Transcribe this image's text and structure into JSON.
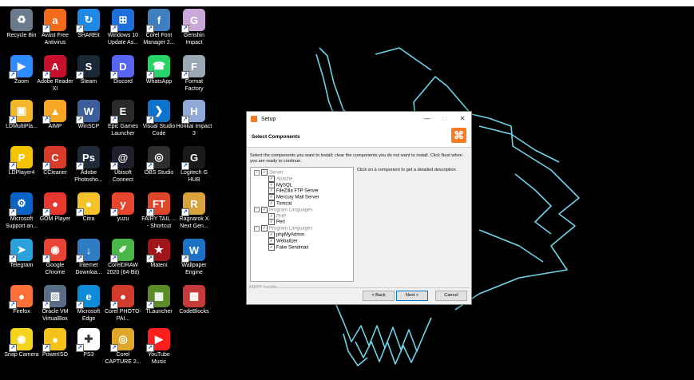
{
  "desktop": {
    "icons": [
      {
        "label": "Recycle Bin",
        "color": "#6b7b8c",
        "glyph": "♻",
        "shortcut": false
      },
      {
        "label": "Avast Free Antivirus",
        "color": "#f26b1d",
        "glyph": "a",
        "shortcut": true
      },
      {
        "label": "SHAREit",
        "color": "#1e88e5",
        "glyph": "↻",
        "shortcut": true
      },
      {
        "label": "Windows 10 Update As...",
        "color": "#1e6fd9",
        "glyph": "⊞",
        "shortcut": true
      },
      {
        "label": "Corel Font Manager 2...",
        "color": "#3f7fc1",
        "glyph": "f",
        "shortcut": true
      },
      {
        "label": "Genshin Impact",
        "color": "#c9a8d9",
        "glyph": "G",
        "shortcut": true
      },
      {
        "label": "Zoom",
        "color": "#2d8cff",
        "glyph": "▶",
        "shortcut": true
      },
      {
        "label": "Adobe Reader XI",
        "color": "#c8102e",
        "glyph": "A",
        "shortcut": true
      },
      {
        "label": "Steam",
        "color": "#1b2838",
        "glyph": "S",
        "shortcut": true
      },
      {
        "label": "Discord",
        "color": "#5865f2",
        "glyph": "D",
        "shortcut": true
      },
      {
        "label": "WhatsApp",
        "color": "#25d366",
        "glyph": "☎",
        "shortcut": true
      },
      {
        "label": "Format Factory",
        "color": "#9aa7b5",
        "glyph": "F",
        "shortcut": true
      },
      {
        "label": "LDMultiPla...",
        "color": "#f3b72b",
        "glyph": "▣",
        "shortcut": true
      },
      {
        "label": "AIMP",
        "color": "#f6a623",
        "glyph": "▲",
        "shortcut": true
      },
      {
        "label": "WinSCP",
        "color": "#3a5f9a",
        "glyph": "W",
        "shortcut": true
      },
      {
        "label": "Epic Games Launcher",
        "color": "#2a2a2a",
        "glyph": "E",
        "shortcut": true
      },
      {
        "label": "Visual Studio Code",
        "color": "#0e74c9",
        "glyph": "❯",
        "shortcut": true
      },
      {
        "label": "Honkai Impact 3",
        "color": "#8fa9d8",
        "glyph": "H",
        "shortcut": true
      },
      {
        "label": "LDPlayer4",
        "color": "#f5c400",
        "glyph": "P",
        "shortcut": true
      },
      {
        "label": "CCleaner",
        "color": "#d83b2a",
        "glyph": "C",
        "shortcut": true
      },
      {
        "label": "Adobe Photosho...",
        "color": "#1f2a3a",
        "glyph": "Ps",
        "shortcut": true
      },
      {
        "label": "Ubisoft Connect",
        "color": "#1f1f2e",
        "glyph": "@",
        "shortcut": true
      },
      {
        "label": "OBS Studio",
        "color": "#302e31",
        "glyph": "◎",
        "shortcut": true
      },
      {
        "label": "Logitech G HUB",
        "color": "#1a1a1a",
        "glyph": "G",
        "shortcut": true
      },
      {
        "label": "Microsoft Support an...",
        "color": "#0a64c8",
        "glyph": "⚙",
        "shortcut": true
      },
      {
        "label": "GOM Player",
        "color": "#e6382e",
        "glyph": "●",
        "shortcut": true
      },
      {
        "label": "Citra",
        "color": "#f4c32a",
        "glyph": "●",
        "shortcut": true
      },
      {
        "label": "yuzu",
        "color": "#e6452e",
        "glyph": "y",
        "shortcut": true
      },
      {
        "label": "FAIRY TAIL ... - Shortcut",
        "color": "#e0462b",
        "glyph": "FT",
        "shortcut": true
      },
      {
        "label": "Ragnarok X Next Gen...",
        "color": "#d8a23c",
        "glyph": "R",
        "shortcut": true
      },
      {
        "label": "Telegram",
        "color": "#2aa1da",
        "glyph": "➤",
        "shortcut": true
      },
      {
        "label": "Google Chrome",
        "color": "#e84335",
        "glyph": "◉",
        "shortcut": true
      },
      {
        "label": "Internet Downloa...",
        "color": "#2f7bc4",
        "glyph": "↓",
        "shortcut": true
      },
      {
        "label": "CorelDRAW 2020 (64-Bit)",
        "color": "#49b649",
        "glyph": "✐",
        "shortcut": true
      },
      {
        "label": "Mateni",
        "color": "#a0161b",
        "glyph": "★",
        "shortcut": true
      },
      {
        "label": "Wallpaper Engine",
        "color": "#1b72c6",
        "glyph": "W",
        "shortcut": true
      },
      {
        "label": "Firefox",
        "color": "#ff7139",
        "glyph": "●",
        "shortcut": true
      },
      {
        "label": "Oracle VM VirtualBox",
        "color": "#5a6d86",
        "glyph": "▨",
        "shortcut": true
      },
      {
        "label": "Microsoft Edge",
        "color": "#0c8bd6",
        "glyph": "e",
        "shortcut": true
      },
      {
        "label": "Corel PHOTO-PAI...",
        "color": "#d23b2b",
        "glyph": "●",
        "shortcut": true
      },
      {
        "label": "TLauncher",
        "color": "#5b8c2a",
        "glyph": "▦",
        "shortcut": true
      },
      {
        "label": "CodeBlocks",
        "color": "#c83a3a",
        "glyph": "▩",
        "shortcut": false
      },
      {
        "label": "Snap Camera",
        "color": "#f5d51c",
        "glyph": "◉",
        "shortcut": true
      },
      {
        "label": "PowerISO",
        "color": "#f5c21b",
        "glyph": "●",
        "shortcut": true
      },
      {
        "label": "PS3",
        "color": "#ffffff",
        "glyph": "✚",
        "shortcut": true
      },
      {
        "label": "Corel CAPTURE 2...",
        "color": "#e1a72a",
        "glyph": "◎",
        "shortcut": true
      },
      {
        "label": "YouTube Music",
        "color": "#ff1e1e",
        "glyph": "▶",
        "shortcut": true
      }
    ]
  },
  "setup": {
    "title": "Setup",
    "header_title": "Select Components",
    "logo_glyph": "⌘",
    "instructions": "Select the components you want to install; clear the components you do not want to install. Click Next when you are ready to continue.",
    "description": "Click on a component to get a detailed description",
    "tree": [
      {
        "label": "Server",
        "level": 0,
        "checked": true,
        "gray": true,
        "group": true
      },
      {
        "label": "Apache",
        "level": 1,
        "checked": true,
        "gray": true
      },
      {
        "label": "MySQL",
        "level": 1,
        "checked": true,
        "gray": false
      },
      {
        "label": "FileZilla FTP Server",
        "level": 1,
        "checked": true,
        "gray": false
      },
      {
        "label": "Mercury Mail Server",
        "level": 1,
        "checked": true,
        "gray": false
      },
      {
        "label": "Tomcat",
        "level": 1,
        "checked": true,
        "gray": false
      },
      {
        "label": "Program Languages",
        "level": 0,
        "checked": true,
        "gray": true,
        "group": true
      },
      {
        "label": "PHP",
        "level": 1,
        "checked": true,
        "gray": true
      },
      {
        "label": "Perl",
        "level": 1,
        "checked": true,
        "gray": false
      },
      {
        "label": "Program Languages",
        "level": 0,
        "checked": true,
        "gray": true,
        "group": true
      },
      {
        "label": "phpMyAdmin",
        "level": 1,
        "checked": true,
        "gray": false
      },
      {
        "label": "Webalizer",
        "level": 1,
        "checked": true,
        "gray": false
      },
      {
        "label": "Fake Sendmail",
        "level": 1,
        "checked": true,
        "gray": false
      }
    ],
    "footer_brand": "XAMPP Installer",
    "back_label": "< Back",
    "next_label": "Next >",
    "cancel_label": "Cancel",
    "minimize_glyph": "—",
    "maximize_glyph": "□",
    "close_glyph": "✕"
  }
}
